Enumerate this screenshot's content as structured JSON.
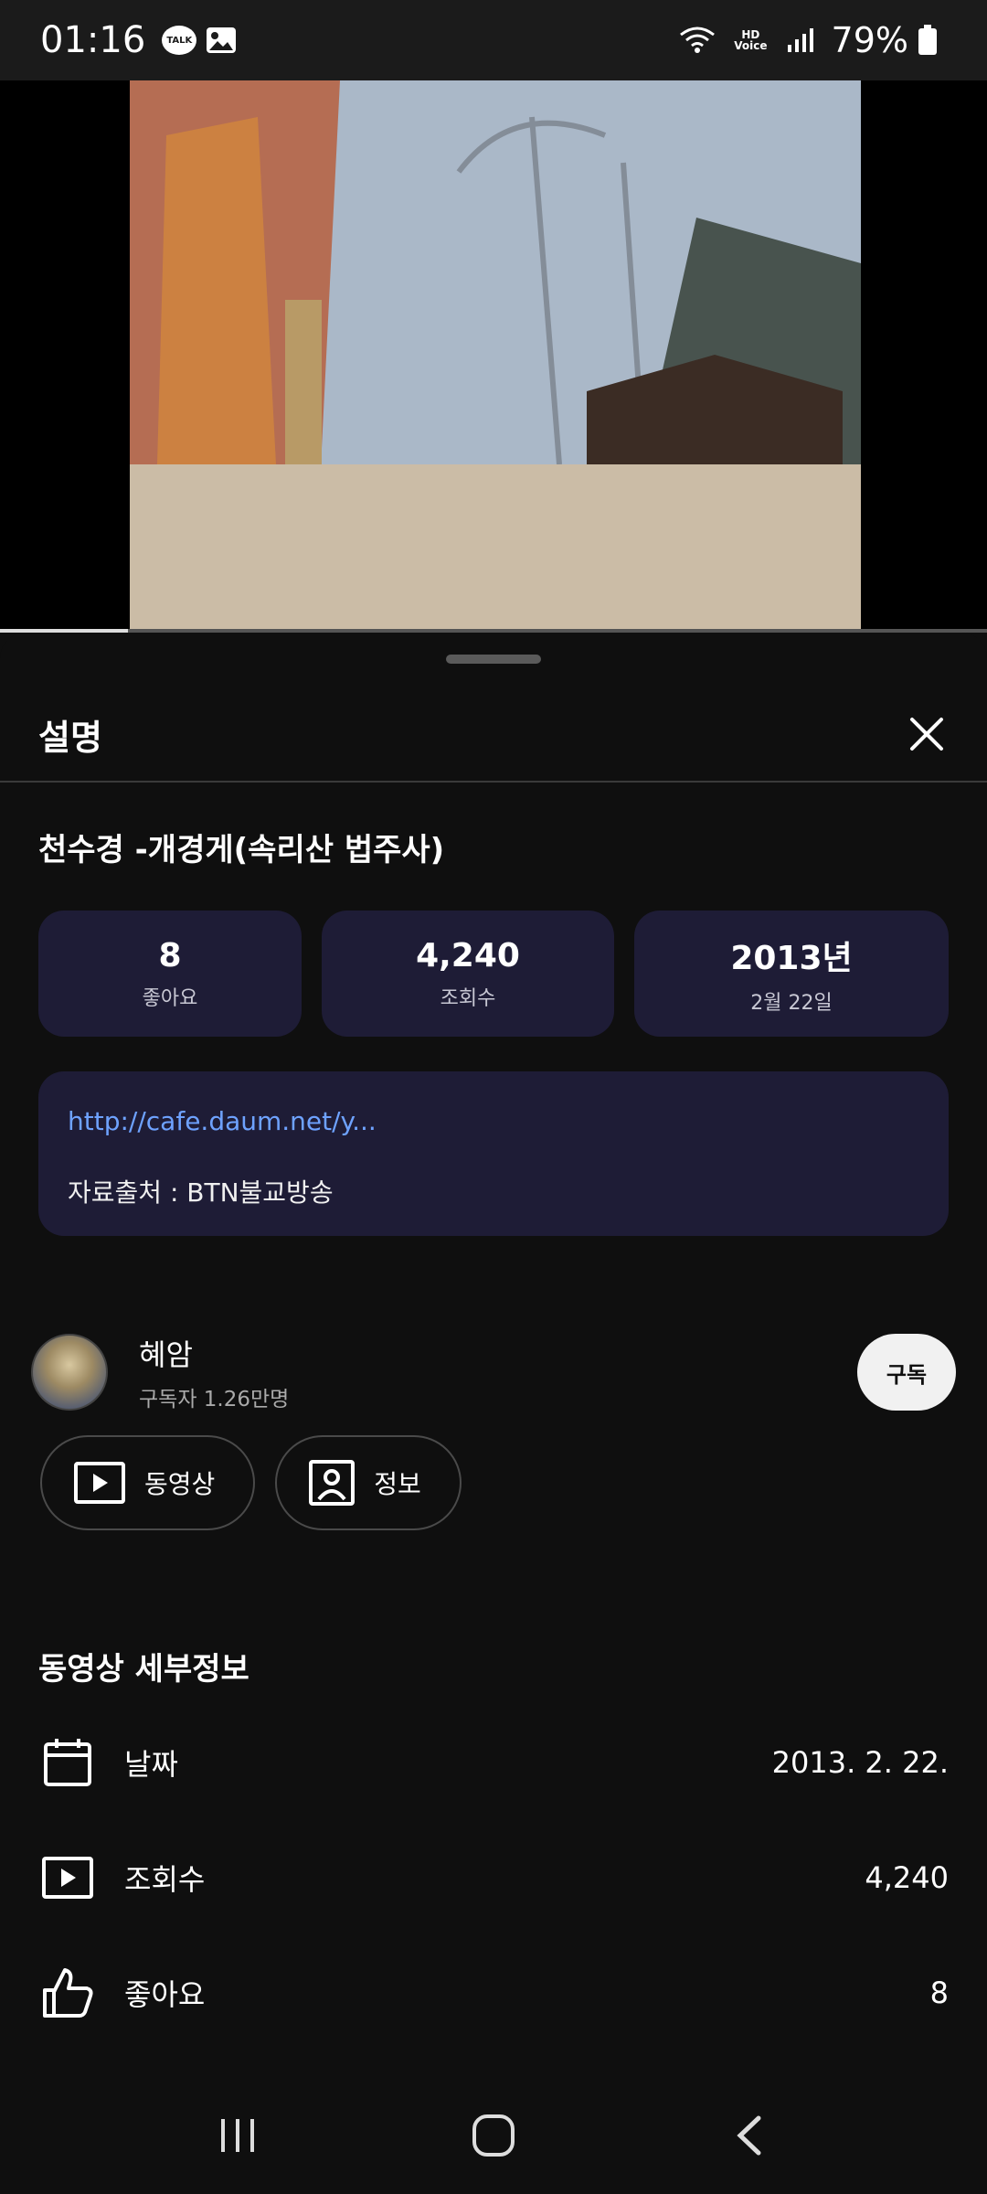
{
  "status_bar": {
    "time": "01:16",
    "talk_badge": "TALK",
    "hd_voice": "HD\nVoice",
    "battery": "79%"
  },
  "video": {
    "progress_fraction": 0.13
  },
  "sheet": {
    "title": "설명",
    "video_title": "천수경 -개경게(속리산 법주사)",
    "stats": [
      {
        "value": "8",
        "label": "좋아요"
      },
      {
        "value": "4,240",
        "label": "조회수"
      },
      {
        "value": "2013년",
        "label": "2월 22일"
      }
    ],
    "description": {
      "link": "http://cafe.daum.net/y...",
      "text": "자료출처 : BTN불교방송"
    },
    "channel": {
      "name": "혜암",
      "subscribers": "구독자 1.26만명",
      "subscribe_label": "구독"
    },
    "chips": [
      {
        "label": "동영상",
        "icon": "play-box-icon"
      },
      {
        "label": "정보",
        "icon": "profile-icon"
      }
    ],
    "details_title": "동영상 세부정보",
    "details": [
      {
        "label": "날짜",
        "value": "2013. 2. 22.",
        "icon": "calendar-icon"
      },
      {
        "label": "조회수",
        "value": "4,240",
        "icon": "play-box-icon"
      },
      {
        "label": "좋아요",
        "value": "8",
        "icon": "thumbs-up-icon"
      }
    ]
  },
  "nav": {
    "buttons": [
      "recent-apps-icon",
      "home-icon",
      "back-icon"
    ]
  }
}
